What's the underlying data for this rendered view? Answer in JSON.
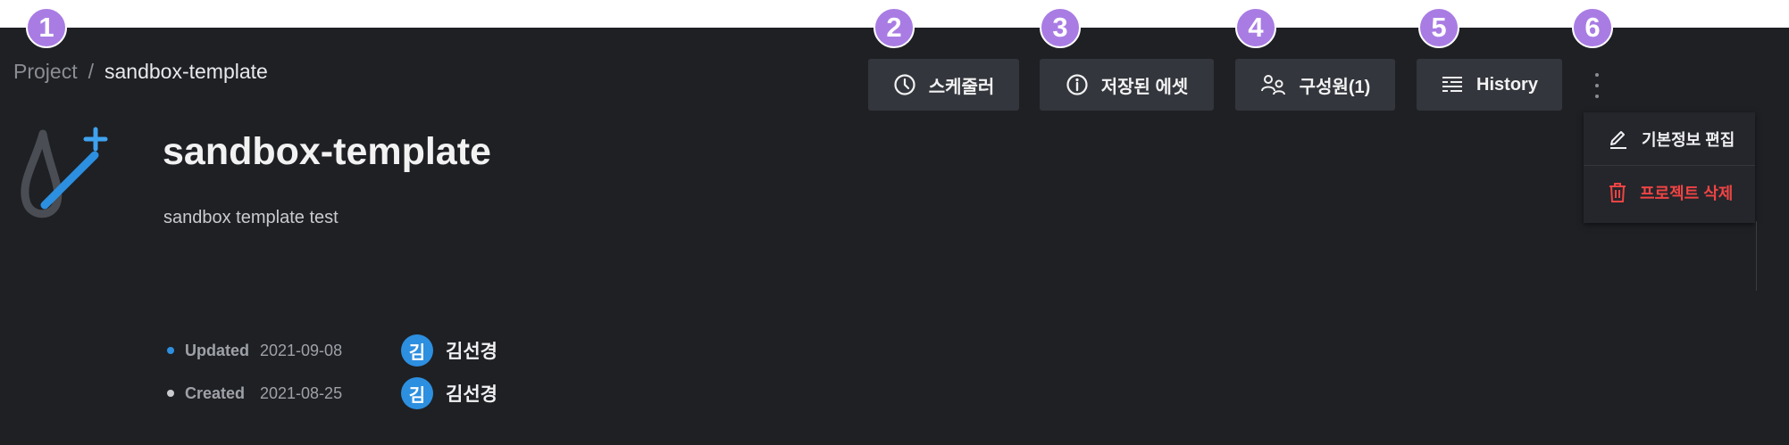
{
  "badges": [
    "1",
    "2",
    "3",
    "4",
    "5",
    "6"
  ],
  "breadcrumb": {
    "root": "Project",
    "separator": "/",
    "current": "sandbox-template"
  },
  "project": {
    "title": "sandbox-template",
    "description": "sandbox template test"
  },
  "meta": {
    "updated": {
      "label": "Updated",
      "date": "2021-09-08",
      "avatar": "김",
      "user": "김선경",
      "dot_color": "#2d8fe0"
    },
    "created": {
      "label": "Created",
      "date": "2021-08-25",
      "avatar": "김",
      "user": "김선경",
      "dot_color": "#c9cbcf"
    }
  },
  "toolbar": {
    "scheduler": {
      "label": "스케줄러",
      "icon": "clock-icon"
    },
    "saved_assets": {
      "label": "저장된 에셋",
      "icon": "info-icon"
    },
    "members": {
      "label": "구성원(1)",
      "icon": "users-icon"
    },
    "history": {
      "label": "History",
      "icon": "list-icon"
    },
    "more": {
      "icon": "kebab-icon"
    }
  },
  "menu": {
    "edit": {
      "label": "기본정보 편집",
      "icon": "pencil-icon"
    },
    "delete": {
      "label": "프로젝트 삭제",
      "icon": "trash-icon",
      "color": "#ef4444"
    }
  },
  "colors": {
    "background": "#1e2024",
    "button": "#33363c",
    "badge": "#a97ce4",
    "accent": "#2d8fe0"
  }
}
